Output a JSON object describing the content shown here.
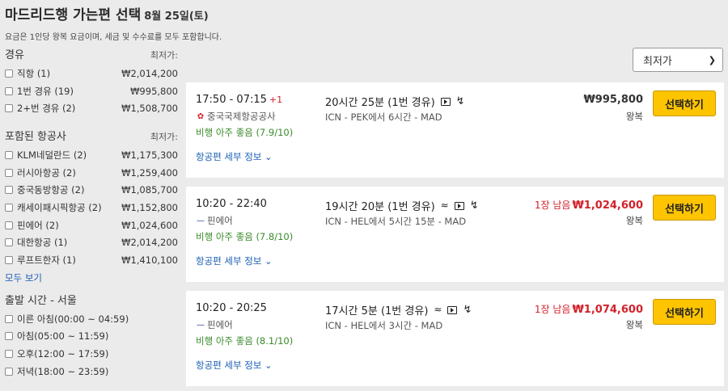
{
  "header": {
    "title": "마드리드행 가는편 선택",
    "date": "8월 25일(토)",
    "subtitle": "요금은 1인당 왕복 요금이며, 세금 및 수수료를 모두 포함합니다."
  },
  "sort": {
    "value": "최저가",
    "icon": "chevron-down-icon"
  },
  "filters": {
    "stops": {
      "title": "경유",
      "col": "최저가:",
      "items": [
        {
          "label": "직항 (1)",
          "price": "₩2,014,200"
        },
        {
          "label": "1번 경유 (19)",
          "price": "₩995,800"
        },
        {
          "label": "2+번 경유 (2)",
          "price": "₩1,508,700"
        }
      ]
    },
    "airlines": {
      "title": "포함된 항공사",
      "col": "최저가:",
      "items": [
        {
          "label": "KLM네덜란드 (2)",
          "price": "₩1,175,300"
        },
        {
          "label": "러시아항공 (2)",
          "price": "₩1,259,400"
        },
        {
          "label": "중국동방항공 (2)",
          "price": "₩1,085,700"
        },
        {
          "label": "캐세이패시픽항공 (2)",
          "price": "₩1,152,800"
        },
        {
          "label": "핀에어 (2)",
          "price": "₩1,024,600"
        },
        {
          "label": "대한항공 (1)",
          "price": "₩2,014,200"
        },
        {
          "label": "루프트한자 (1)",
          "price": "₩1,410,100"
        }
      ],
      "show_all": "모두 보기"
    },
    "departure": {
      "title": "출발 시간 - 서울",
      "items": [
        {
          "label": "이른 아침(00:00 ~ 04:59)"
        },
        {
          "label": "아침(05:00 ~ 11:59)"
        },
        {
          "label": "오후(12:00 ~ 17:59)"
        },
        {
          "label": "저녁(18:00 ~ 23:59)"
        }
      ]
    }
  },
  "flights": [
    {
      "times": "17:50 - 07:15",
      "day_offset": "+1",
      "airline": "중국국제항공공사",
      "rating": "비행 아주 좋음 (7.9/10)",
      "duration": "20시간 25분 (1번 경유)",
      "route": "ICN - PEK에서 6시간 - MAD",
      "seats_left": "",
      "price": "₩995,800",
      "trip": "왕복",
      "select": "선택하기",
      "details": "항공편 세부 정보"
    },
    {
      "times": "10:20 - 22:40",
      "day_offset": "",
      "airline": "핀에어",
      "rating": "비행 아주 좋음 (7.8/10)",
      "duration": "19시간 20분 (1번 경유)",
      "route": "ICN - HEL에서 5시간 15분 - MAD",
      "seats_left": "1장 남음",
      "price": "₩1,024,600",
      "trip": "왕복",
      "select": "선택하기",
      "details": "항공편 세부 정보"
    },
    {
      "times": "10:20 - 20:25",
      "day_offset": "",
      "airline": "핀에어",
      "rating": "비행 아주 좋음 (8.1/10)",
      "duration": "17시간 5분 (1번 경유)",
      "route": "ICN - HEL에서 3시간 - MAD",
      "seats_left": "1장 남음",
      "price": "₩1,074,600",
      "trip": "왕복",
      "select": "선택하기",
      "details": "항공편 세부 정보"
    }
  ],
  "colors": {
    "accent_yellow": "#ffc400",
    "link_blue": "#1b5fb4",
    "alert_red": "#d3202a",
    "rating_green": "#3a8a2a"
  }
}
